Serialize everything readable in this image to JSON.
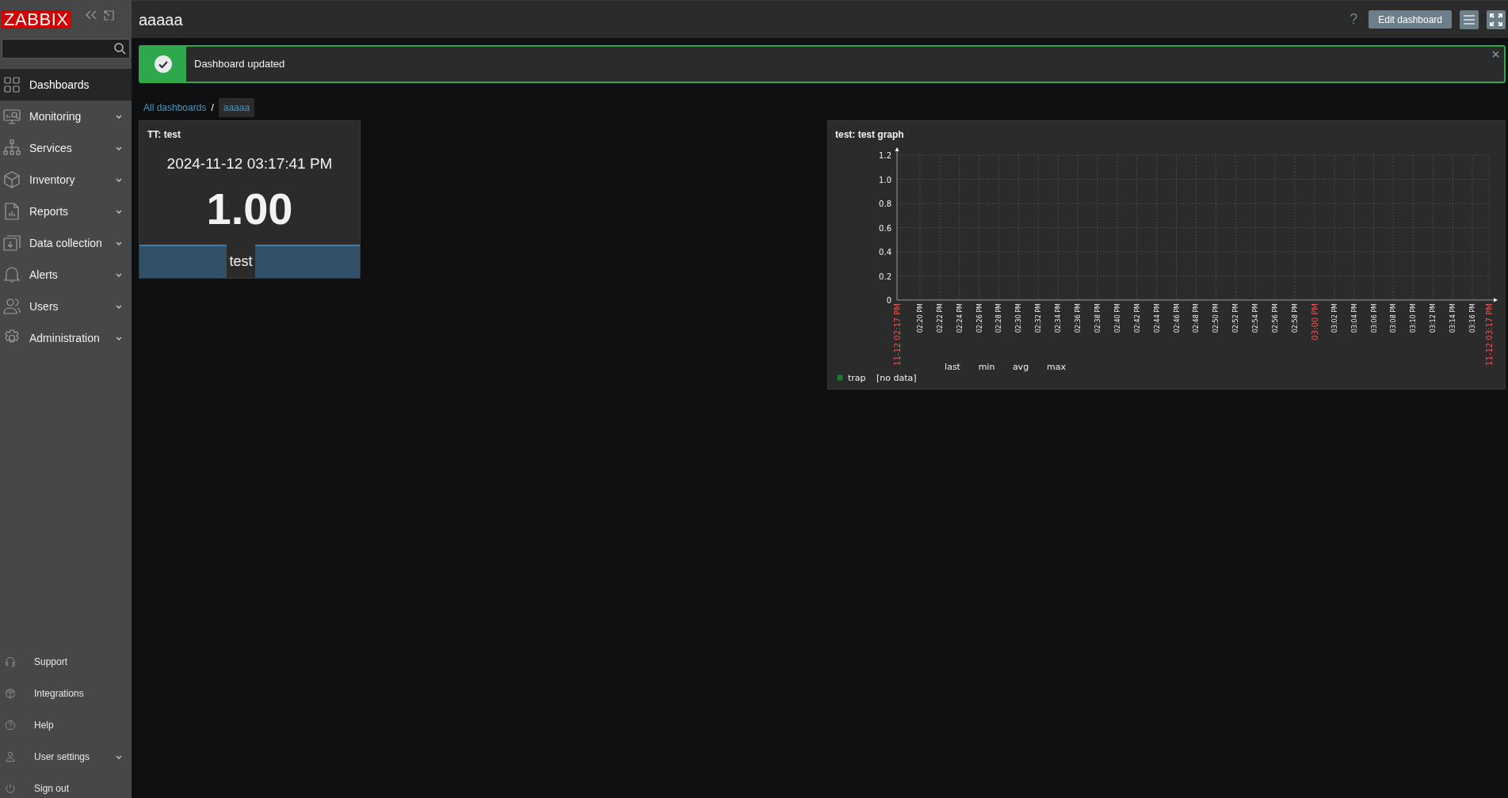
{
  "sidebar": {
    "logo": "ZABBIX",
    "menu": [
      {
        "label": "Dashboards",
        "kind": "dashboards",
        "selected": true,
        "has_submenu": false
      },
      {
        "label": "Monitoring",
        "kind": "monitoring",
        "selected": false,
        "has_submenu": true
      },
      {
        "label": "Services",
        "kind": "services",
        "selected": false,
        "has_submenu": true
      },
      {
        "label": "Inventory",
        "kind": "inventory",
        "selected": false,
        "has_submenu": true
      },
      {
        "label": "Reports",
        "kind": "reports",
        "selected": false,
        "has_submenu": true
      },
      {
        "label": "Data collection",
        "kind": "datacollection",
        "selected": false,
        "has_submenu": true
      },
      {
        "label": "Alerts",
        "kind": "alerts",
        "selected": false,
        "has_submenu": true
      },
      {
        "label": "Users",
        "kind": "users",
        "selected": false,
        "has_submenu": true
      },
      {
        "label": "Administration",
        "kind": "administration",
        "selected": false,
        "has_submenu": true
      }
    ],
    "footer": [
      {
        "label": "Support",
        "kind": "support",
        "has_submenu": false
      },
      {
        "label": "Integrations",
        "kind": "integrations",
        "has_submenu": false
      },
      {
        "label": "Help",
        "kind": "help",
        "has_submenu": false
      },
      {
        "label": "User settings",
        "kind": "usersettings",
        "has_submenu": true
      },
      {
        "label": "Sign out",
        "kind": "signout",
        "has_submenu": false
      }
    ]
  },
  "header": {
    "title": "aaaaa",
    "help": "?",
    "edit_button": "Edit dashboard"
  },
  "message": {
    "kind": "success",
    "text": "Dashboard updated"
  },
  "breadcrumbs": [
    {
      "label": "All dashboards",
      "selected": false
    },
    {
      "label": "aaaaa",
      "selected": true
    }
  ],
  "breadcrumb_separator": "/",
  "item_widget": {
    "title": "TT: test",
    "time": "2024-11-12 03:17:41 PM",
    "value": "1.00",
    "label": "test"
  },
  "graph_widget": {
    "title": "test: test graph",
    "chart_data": {
      "type": "line",
      "grid": true,
      "ylim": [
        0,
        1.2
      ],
      "yticks": [
        0,
        0.2,
        0.4,
        0.6,
        0.8,
        {
          "value": 1,
          "label": "1.0"
        },
        1.2
      ],
      "categories": [
        "11-12 02:17 PM",
        "02:20 PM",
        "02:22 PM",
        "02:24 PM",
        "02:26 PM",
        "02:28 PM",
        "02:30 PM",
        "02:32 PM",
        "02:34 PM",
        "02:36 PM",
        "02:38 PM",
        "02:40 PM",
        "02:42 PM",
        "02:44 PM",
        "02:46 PM",
        "02:48 PM",
        "02:50 PM",
        "02:52 PM",
        "02:54 PM",
        "02:56 PM",
        "02:58 PM",
        "03:00 PM",
        "03:02 PM",
        "03:04 PM",
        "03:06 PM",
        "03:08 PM",
        "03:10 PM",
        "03:12 PM",
        "03:14 PM",
        "03:16 PM",
        "11-12 03:17 PM"
      ],
      "series": [
        {
          "name": "trap",
          "color": "#1e7a2e",
          "values": [
            null,
            null,
            null,
            null,
            null,
            null,
            null,
            null,
            null,
            null,
            null,
            null,
            null,
            null,
            null,
            null,
            null,
            null,
            null,
            null,
            null,
            null,
            null,
            null,
            null,
            null,
            null,
            null,
            null,
            null,
            null
          ]
        }
      ]
    },
    "x_label_highlighted": [
      true,
      false,
      false,
      false,
      false,
      false,
      false,
      false,
      false,
      false,
      false,
      false,
      false,
      false,
      false,
      false,
      false,
      false,
      false,
      false,
      false,
      true,
      false,
      false,
      false,
      false,
      false,
      false,
      false,
      false,
      true
    ],
    "legend": {
      "columns": [
        "last",
        "min",
        "avg",
        "max"
      ],
      "entries": [
        "[no data]"
      ]
    }
  }
}
